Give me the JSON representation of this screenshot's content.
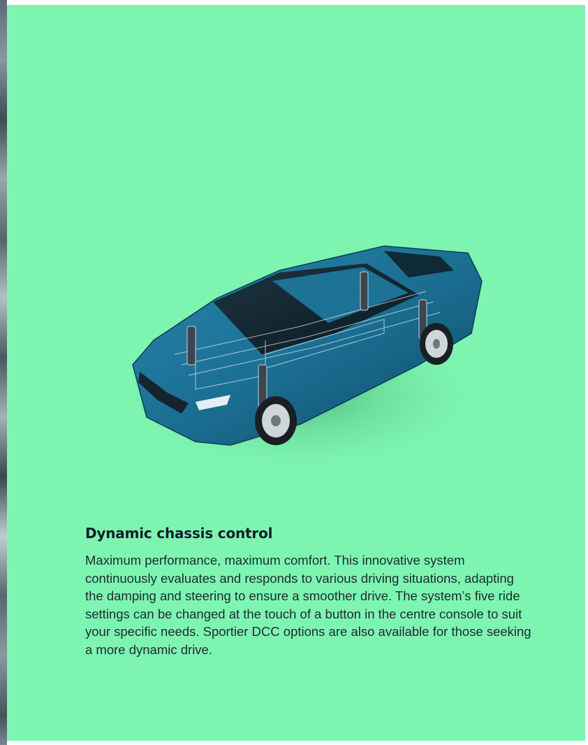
{
  "colors": {
    "page_bg": "#7df5b0",
    "car_body": "#1b6f93",
    "text": "#1c2b33"
  },
  "hero": {
    "icon": "car-chassis-illustration"
  },
  "section": {
    "title": "Dynamic chassis control",
    "body": "Maximum performance, maximum comfort. This innovative system continuously evaluates and responds to various driving situations, adapting the damping and steering to ensure a smoother drive. The system’s five ride settings can be changed at the touch of a button in the centre console to suit your specific needs. Sportier DCC options are also available for those seeking a more dynamic drive."
  }
}
